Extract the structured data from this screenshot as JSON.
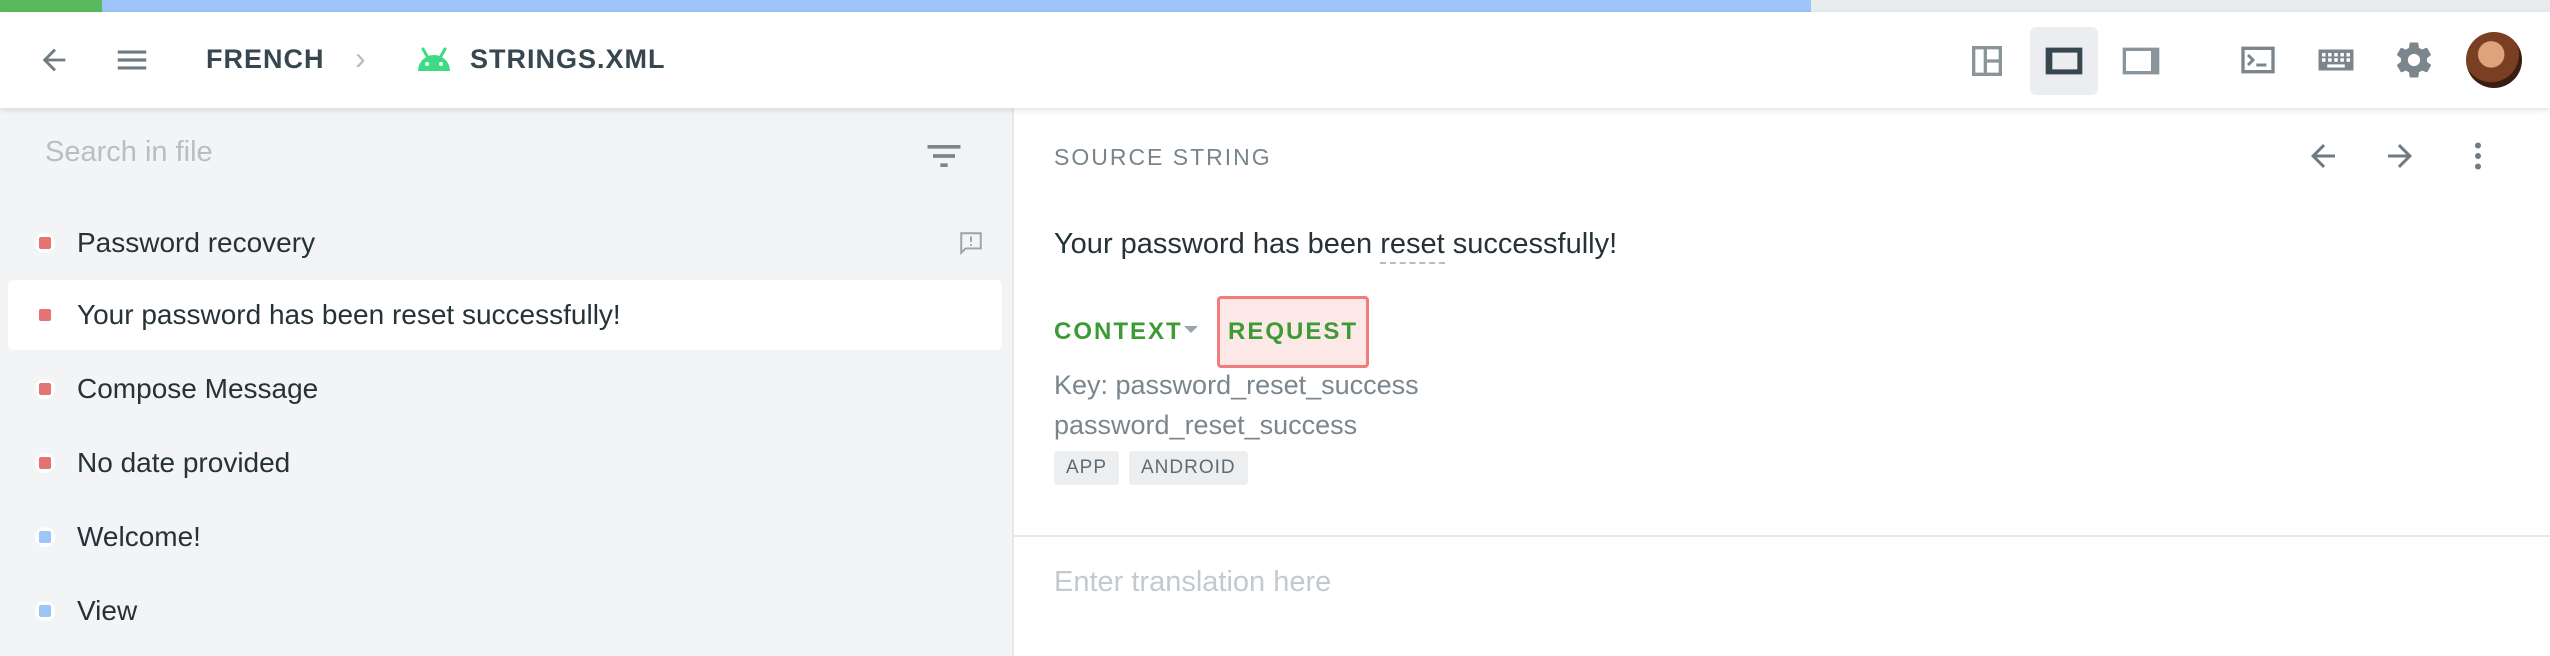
{
  "progress": {
    "translated_fraction": 0.04,
    "in_progress_fraction": 0.71
  },
  "topbar": {
    "back_icon": "arrow-left-icon",
    "menu_icon": "hamburger-menu-icon",
    "breadcrumb": [
      {
        "label": "FRENCH"
      },
      {
        "label": "STRINGS.XML",
        "icon": "android-icon"
      }
    ],
    "view_modes": [
      {
        "icon": "layout-grid-icon",
        "active": false
      },
      {
        "icon": "layout-left-panel-icon",
        "active": true
      },
      {
        "icon": "layout-right-panel-icon",
        "active": false
      }
    ],
    "tools": [
      "terminal-icon",
      "keyboard-icon",
      "gear-icon"
    ],
    "avatar": "user-avatar"
  },
  "left_panel": {
    "search_placeholder": "Search in file",
    "strings": [
      {
        "text": "Password recovery",
        "status": "untranslated",
        "has_comment": true
      },
      {
        "text": "Your password has been reset successfully!",
        "status": "untranslated",
        "selected": true
      },
      {
        "text": "Compose Message",
        "status": "untranslated"
      },
      {
        "text": "No date provided",
        "status": "untranslated"
      },
      {
        "text": "Welcome!",
        "status": "translated"
      },
      {
        "text": "View",
        "status": "translated"
      }
    ],
    "status_colors": {
      "untranslated": "#e57373",
      "translated": "#9ec5f8"
    }
  },
  "editor": {
    "section_label": "SOURCE STRING",
    "source": {
      "before": "Your password has been ",
      "term": "reset",
      "after": " successfully!"
    },
    "context_label": "CONTEXT",
    "request_label": "REQUEST",
    "key_line": "Key: password_reset_success",
    "identifier": "password_reset_success",
    "tags": [
      "APP",
      "ANDROID"
    ],
    "translation_placeholder": "Enter translation here"
  },
  "colors": {
    "accent_green": "#3c9b35",
    "request_border": "#f07c7c",
    "request_bg": "#fde8e8"
  }
}
